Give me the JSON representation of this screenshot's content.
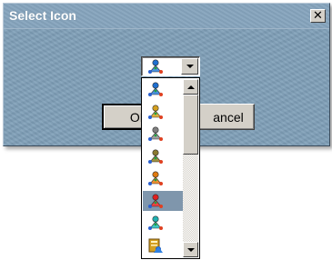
{
  "window": {
    "title": "Select Icon",
    "close_icon": "close-icon"
  },
  "buttons": {
    "ok_label": "OK",
    "cancel_label": "ancel"
  },
  "combo": {
    "selected_icon": "user-icon-blue"
  },
  "dropdown": {
    "items": [
      {
        "icon": "user-icon-blue",
        "head": "#1e6fd0",
        "body": "#4a90e0",
        "selected": false
      },
      {
        "icon": "user-icon-gold",
        "head": "#d4a020",
        "body": "#e0b040",
        "selected": false
      },
      {
        "icon": "user-icon-gray",
        "head": "#808080",
        "body": "#a0a0a0",
        "selected": false
      },
      {
        "icon": "user-icon-olive",
        "head": "#8a7a30",
        "body": "#a09040",
        "selected": false
      },
      {
        "icon": "user-icon-orange",
        "head": "#e07a10",
        "body": "#f09030",
        "selected": false
      },
      {
        "icon": "user-icon-red",
        "head": "#e02020",
        "body": "#f04040",
        "selected": true
      },
      {
        "icon": "user-icon-cyan",
        "head": "#20b0b0",
        "body": "#40c8c8",
        "selected": false
      },
      {
        "icon": "user-card-icon",
        "head": "#d4a020",
        "body": "#c07010",
        "selected": false
      }
    ]
  },
  "colors": {
    "dialog_bg": "#7f9fb8",
    "selection": "#7f96ac",
    "face": "#d4d0c8"
  }
}
